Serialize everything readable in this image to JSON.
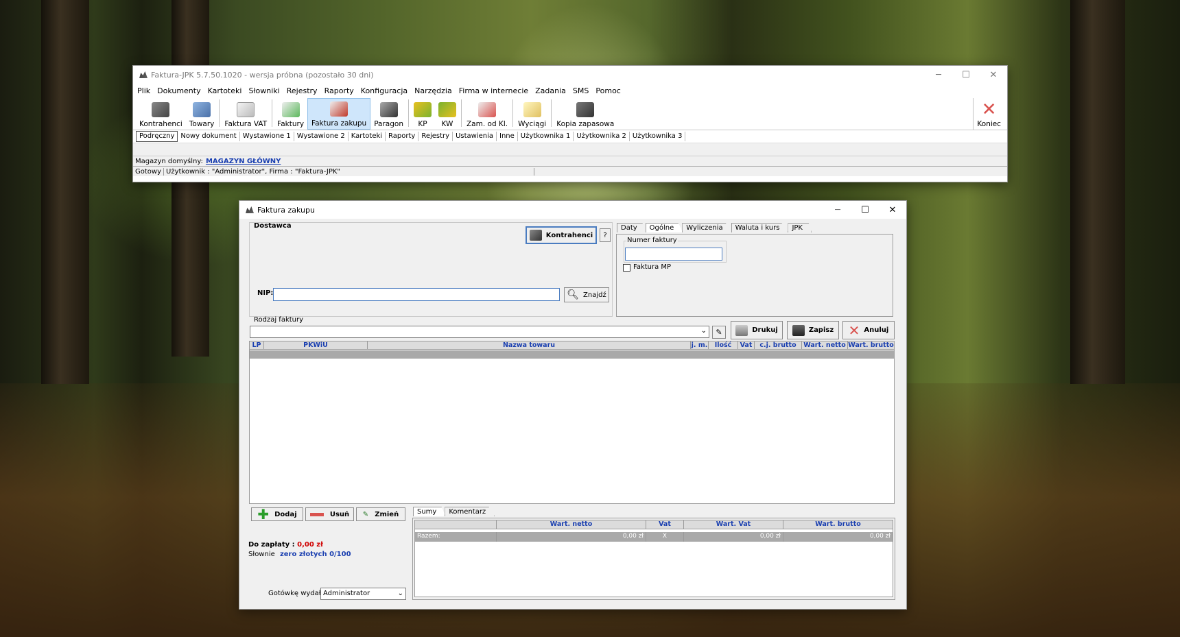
{
  "main_window": {
    "title": "Faktura-JPK 5.7.50.1020 - wersja próbna (pozostało 30 dni)",
    "menu": [
      "Plik",
      "Dokumenty",
      "Kartoteki",
      "Słowniki",
      "Rejestry",
      "Raporty",
      "Konfiguracja",
      "Narzędzia",
      "Firma w internecie",
      "Zadania",
      "SMS",
      "Pomoc"
    ],
    "toolbar": [
      "Kontrahenci",
      "Towary",
      "Faktura VAT",
      "Faktury",
      "Faktura zakupu",
      "Paragon",
      "KP",
      "KW",
      "Zam. od Kl.",
      "Wyciągi",
      "Kopia zapasowa"
    ],
    "toolbar_end": "Koniec",
    "subtabs": [
      "Podręczny",
      "Nowy dokument",
      "Wystawione 1",
      "Wystawione 2",
      "Kartoteki",
      "Raporty",
      "Rejestry",
      "Ustawienia",
      "Inne",
      "Użytkownika 1",
      "Użytkownika 2",
      "Użytkownika 3"
    ],
    "warehouse_label": "Magazyn domyślny:",
    "warehouse_value": "MAGAZYN GŁÓWNY",
    "status_ready": "Gotowy",
    "status_user": "Użytkownik : \"Administrator\", Firma : \"Faktura-JPK\""
  },
  "dialog": {
    "title": "Faktura zakupu",
    "supplier_group": "Dostawca",
    "contractors_button": "Kontrahenci",
    "help_button": "?",
    "nip_label": "NIP:",
    "nip_value": "",
    "find_button": "Znajdź",
    "right_tabs": [
      "Daty",
      "Ogólne",
      "Wyliczenia",
      "Waluta i kurs",
      "JPK"
    ],
    "invoice_number_label": "Numer faktury",
    "invoice_number_value": "",
    "mp_checkbox": "Faktura MP",
    "invoice_type_label": "Rodzaj faktury",
    "print_button": "Drukuj",
    "save_button": "Zapisz",
    "cancel_button": "Anuluj",
    "items_columns": [
      "LP",
      "PKWiU",
      "Nazwa towaru",
      "j. m.",
      "Ilość",
      "Vat",
      "c.j. brutto",
      "Wart. netto",
      "Wart. brutto"
    ],
    "add_button": "Dodaj",
    "remove_button": "Usuń",
    "change_button": "Zmień",
    "to_pay_label": "Do zapłaty :",
    "to_pay_value": "0,00 zł",
    "in_words_label": "Słownie",
    "in_words_value": "zero złotych 0/100",
    "cash_label": "Gotówkę wydał",
    "cash_value": "Administrator",
    "bottom_tabs": [
      "Sumy",
      "Komentarz"
    ],
    "sum_columns": [
      "Wart. netto",
      "Vat",
      "Wart. Vat",
      "Wart. brutto"
    ],
    "sum_row": {
      "label": "Razem:",
      "netto": "0,00 zł",
      "vat": "X",
      "vat_value": "0,00 zł",
      "brutto": "0,00 zł"
    }
  },
  "colors": {
    "accent_blue": "#1a3fb0",
    "red_value": "#d00000",
    "active_tool": "#cfe6fb"
  }
}
